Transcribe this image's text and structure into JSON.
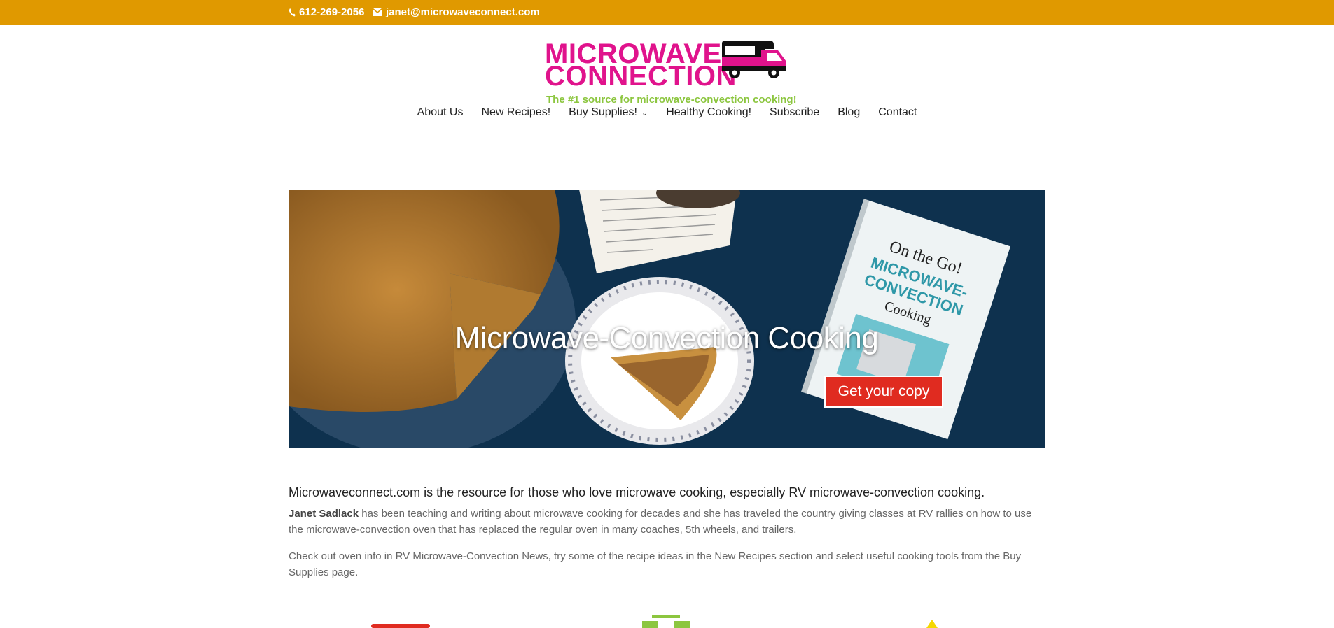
{
  "topbar": {
    "phone": "612-269-2056",
    "email": "janet@microwaveconnect.com",
    "icons": [
      "phone-icon",
      "mail-icon"
    ]
  },
  "logo": {
    "line1": "MICROWAVE",
    "line2": "CONNECTION",
    "tagline": "The #1 source for microwave-convection cooking!",
    "brand_color": "#e0138c",
    "tagline_color": "#8cc63f"
  },
  "nav": {
    "items": [
      {
        "label": "About Us"
      },
      {
        "label": "New Recipes!"
      },
      {
        "label": "Buy Supplies!",
        "has_dropdown": true
      },
      {
        "label": "Healthy Cooking!"
      },
      {
        "label": "Subscribe"
      },
      {
        "label": "Blog"
      },
      {
        "label": "Contact"
      }
    ]
  },
  "hero": {
    "title": "Microwave-Convection Cooking",
    "button": "Get your copy",
    "button_color": "#e02b20"
  },
  "content": {
    "lead": "Microwaveconnect.com is the resource for those who love microwave cooking, especially RV microwave-convection cooking.",
    "p1_name": "Janet Sadlack",
    "p1_rest": " has been teaching and writing about microwave cooking for decades and she has traveled the country giving classes at RV rallies on how to use the microwave-convection oven that has replaced the regular oven in many coaches, 5th wheels, and trailers.",
    "p2": "Check out oven info in RV Microwave-Convection News, try some of the recipe ideas in the New Recipes section and select useful cooking tools from the Buy Supplies page."
  },
  "colors": {
    "topbar": "#e09900",
    "text": "#666666"
  }
}
